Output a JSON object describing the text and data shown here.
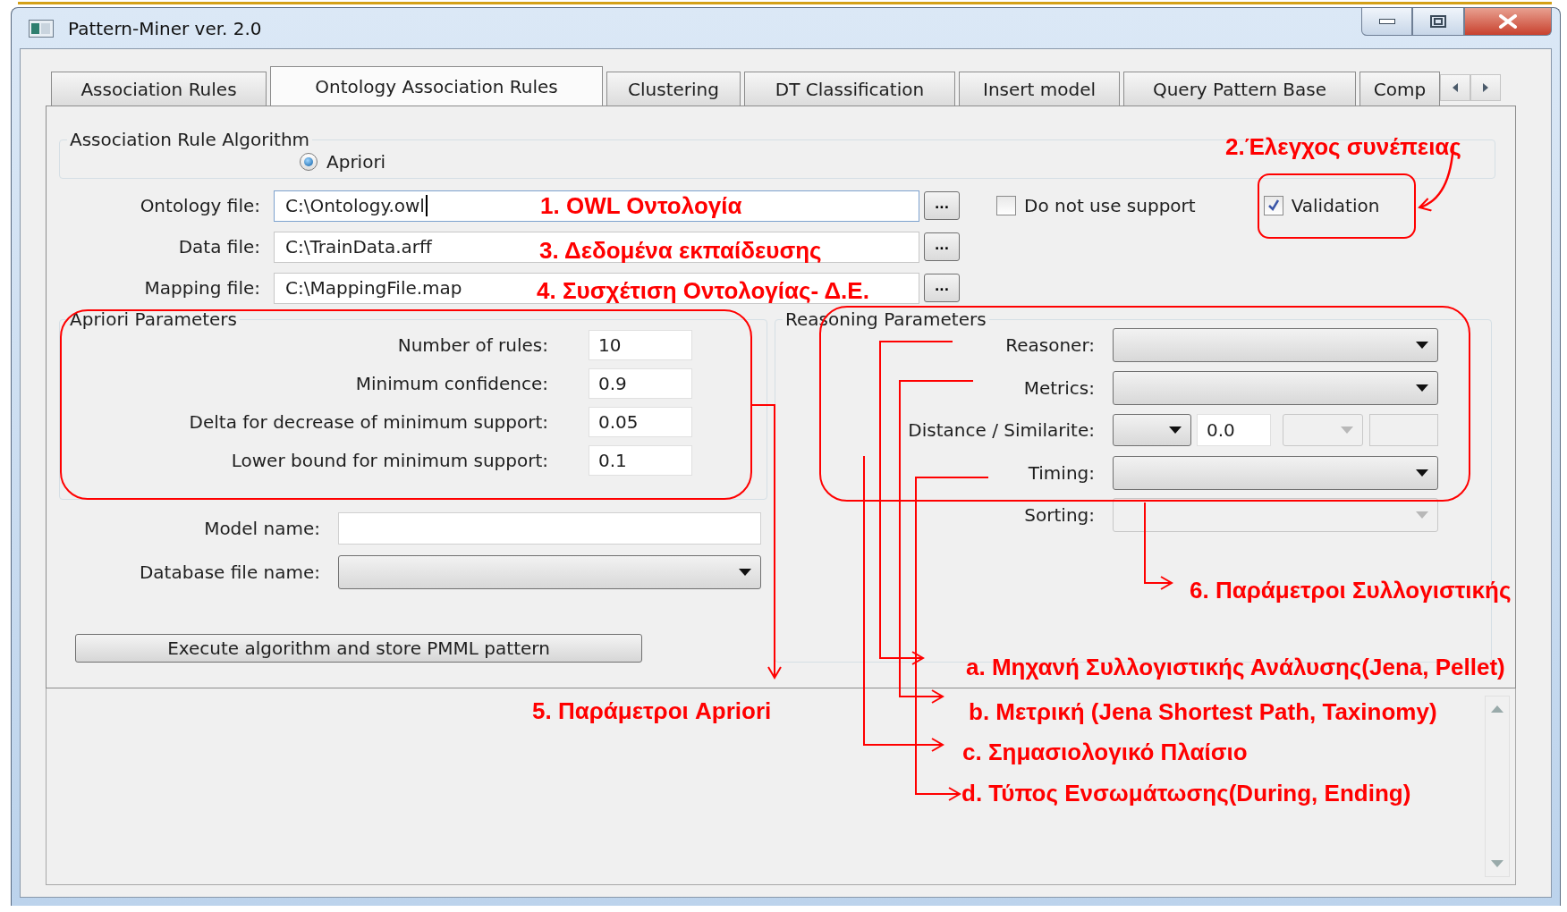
{
  "window": {
    "title": "Pattern-Miner ver. 2.0"
  },
  "tabs": [
    {
      "label": "Association Rules",
      "selected": false
    },
    {
      "label": "Ontology Association Rules",
      "selected": true
    },
    {
      "label": "Clustering",
      "selected": false
    },
    {
      "label": "DT Classification",
      "selected": false
    },
    {
      "label": "Insert model",
      "selected": false
    },
    {
      "label": "Query Pattern Base",
      "selected": false
    },
    {
      "label": "Comp",
      "selected": false
    }
  ],
  "algorithm_group": {
    "title": "Association Rule Algorithm",
    "options": [
      {
        "label": "Apriori",
        "selected": true
      }
    ]
  },
  "file_fields": [
    {
      "label": "Ontology file:",
      "value": "C:\\Ontology.owl",
      "focused": true,
      "button": "..."
    },
    {
      "label": "Data file:",
      "value": "C:\\TrainData.arff",
      "focused": false,
      "button": "..."
    },
    {
      "label": "Mapping file:",
      "value": "C:\\MappingFile.map",
      "focused": false,
      "button": "..."
    }
  ],
  "checkboxes": [
    {
      "label": "Do not use support",
      "checked": false
    },
    {
      "label": "Validation",
      "checked": true
    }
  ],
  "apriori_parameters": {
    "title": "Apriori Parameters",
    "fields": [
      {
        "label": "Number of rules:",
        "value": "10"
      },
      {
        "label": "Minimum confidence:",
        "value": "0.9"
      },
      {
        "label": "Delta for decrease of minimum support:",
        "value": "0.05"
      },
      {
        "label": "Lower bound for minimum support:",
        "value": "0.1"
      }
    ]
  },
  "model_name": {
    "label": "Model name:"
  },
  "database_file": {
    "label": "Database file name:"
  },
  "execute_button": "Execute algorithm and store PMML pattern",
  "reasoning_parameters": {
    "title": "Reasoning Parameters",
    "rows": [
      {
        "kind": "combo",
        "label": "Reasoner:",
        "disabled": false
      },
      {
        "kind": "combo",
        "label": "Metrics:",
        "disabled": false
      },
      {
        "kind": "distance",
        "label": "Distance / Similarite:",
        "value": "0.0",
        "unit_disabled": true
      },
      {
        "kind": "combo",
        "label": "Timing:",
        "disabled": false
      },
      {
        "kind": "combo",
        "label": "Sorting:",
        "disabled": true
      }
    ]
  },
  "annotations": [
    {
      "text": "1. OWL Οντολογία"
    },
    {
      "text": "2.Έλεγχος συνέπειας"
    },
    {
      "text": "3. Δεδομένα εκπαίδευσης"
    },
    {
      "text": "4. Συσχέτιση Οντολογίας- Δ.Ε."
    },
    {
      "text": "5. Παράμετροι Apriori"
    },
    {
      "text": "6. Παράμετροι Συλλογιστικής"
    },
    {
      "text": "a. Μηχανή Συλλογιστικής Ανάλυσης(Jena, Pellet)"
    },
    {
      "text": "b. Μετρική (Jena Shortest Path, Taxinomy)"
    },
    {
      "text": "c. Σημασιολογικό Πλαίσιο"
    },
    {
      "text": "d. Τύπος Ενσωμάτωσης(During, Ending)"
    }
  ]
}
